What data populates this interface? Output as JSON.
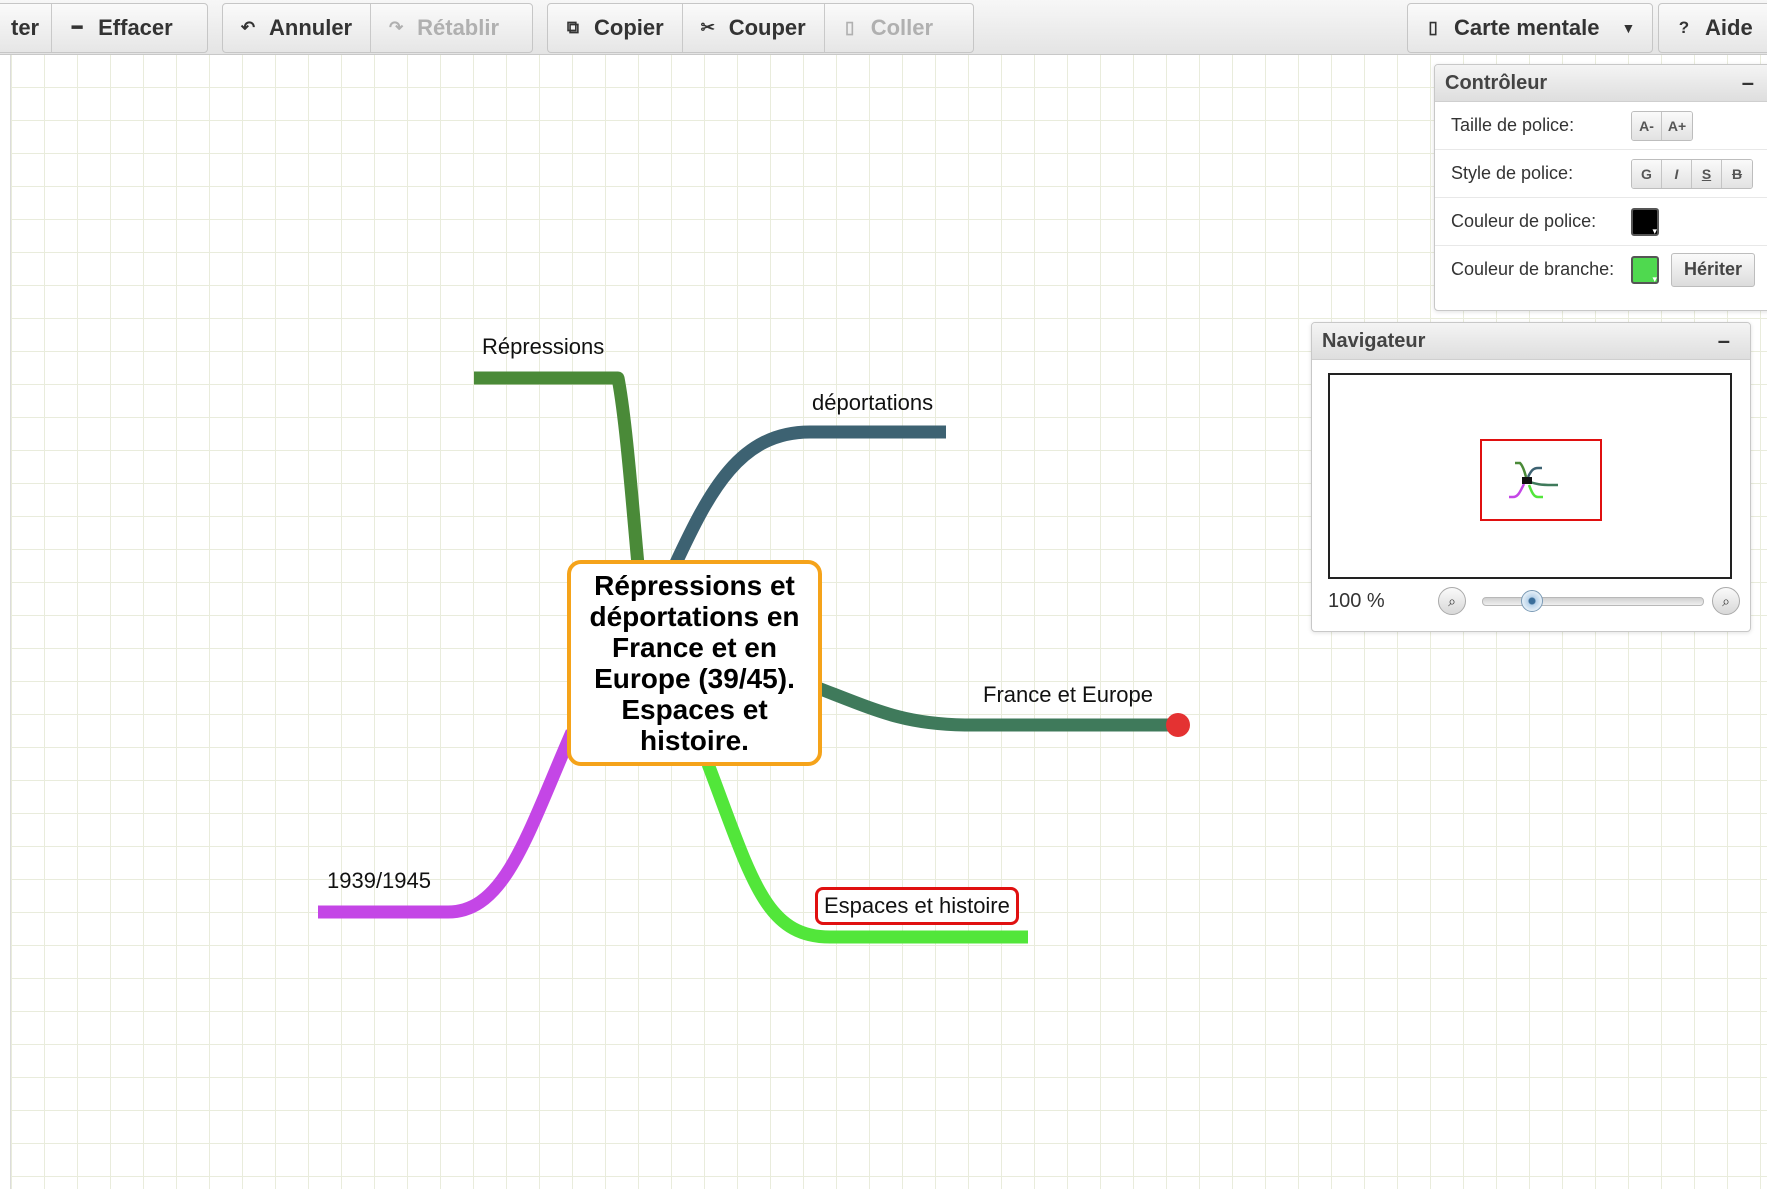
{
  "toolbar": {
    "partial_label": "ter",
    "effacer": "Effacer",
    "annuler": "Annuler",
    "retablir": "Rétablir",
    "copier": "Copier",
    "couper": "Couper",
    "coller": "Coller",
    "carte_mentale": "Carte mentale",
    "aide": "Aide",
    "icons": {
      "effacer": "minus-icon",
      "annuler": "undo-icon",
      "retablir": "redo-icon",
      "copier": "copy-icon",
      "couper": "scissors-icon",
      "coller": "paste-icon",
      "carte_mentale": "document-icon",
      "aide": "question-icon"
    }
  },
  "controller": {
    "title": "Contrôleur",
    "font_size_label": "Taille de police:",
    "font_size_buttons": [
      "A-",
      "A+"
    ],
    "font_style_label": "Style de police:",
    "font_style_buttons": [
      "G",
      "I",
      "S",
      "B"
    ],
    "font_color_label": "Couleur de police:",
    "font_color": "#000000",
    "branch_color_label": "Couleur de branche:",
    "branch_color": "#4fd94f",
    "inherit_label": "Hériter"
  },
  "navigator": {
    "title": "Navigateur",
    "zoom_label": "100 %",
    "zoom_slider_fraction": 0.22
  },
  "mindmap": {
    "central": "Répressions et déportations en France et en Europe (39/45). Espaces et histoire.",
    "central_border_color": "#f5a31a",
    "branches": [
      {
        "label": "Répressions",
        "color": "#4a8a38"
      },
      {
        "label": "déportations",
        "color": "#3d6272"
      },
      {
        "label": "France et Europe",
        "color": "#3f7a5b"
      },
      {
        "label": "Espaces et histoire",
        "color": "#52e63a",
        "selected": true
      },
      {
        "label": "1939/1945",
        "color": "#c446e6"
      }
    ]
  }
}
